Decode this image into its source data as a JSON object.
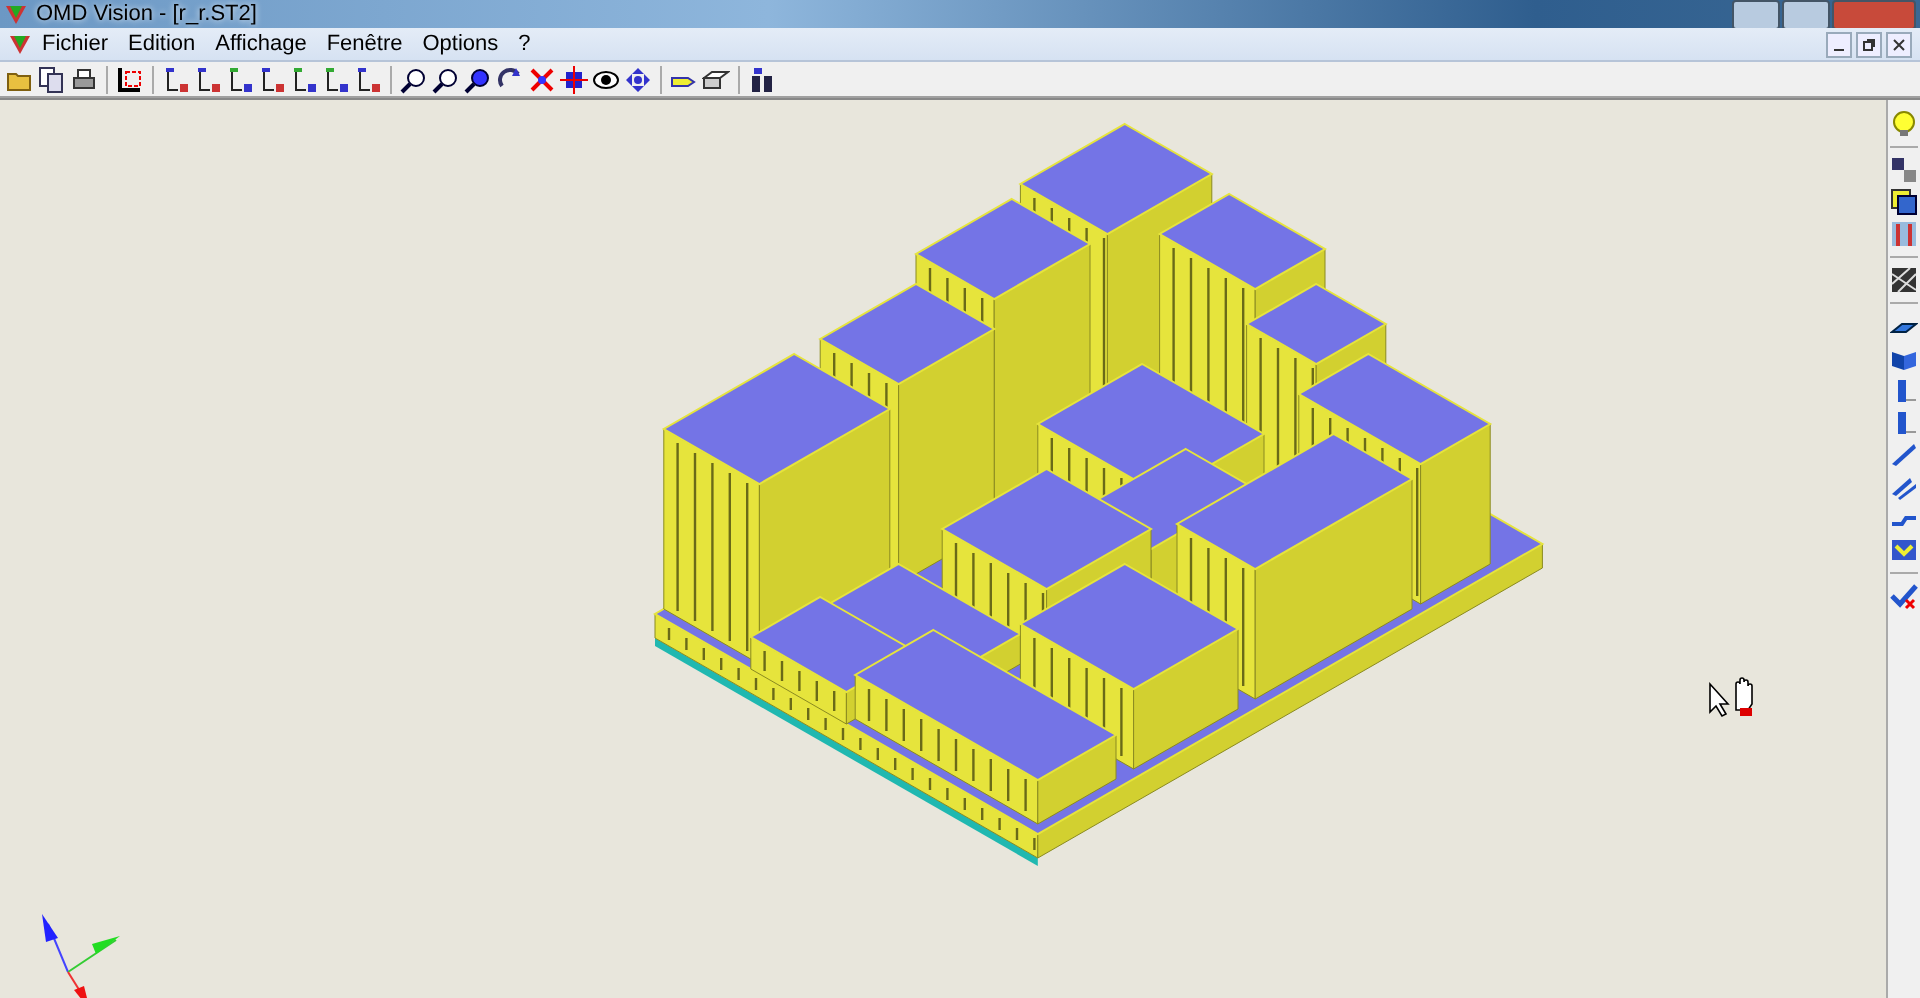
{
  "window": {
    "title": "OMD Vision - [r_r.ST2]"
  },
  "menu": [
    {
      "label": "Fichier"
    },
    {
      "label": "Edition"
    },
    {
      "label": "Affichage"
    },
    {
      "label": "Fenêtre"
    },
    {
      "label": "Options"
    },
    {
      "label": "?"
    }
  ]
}
